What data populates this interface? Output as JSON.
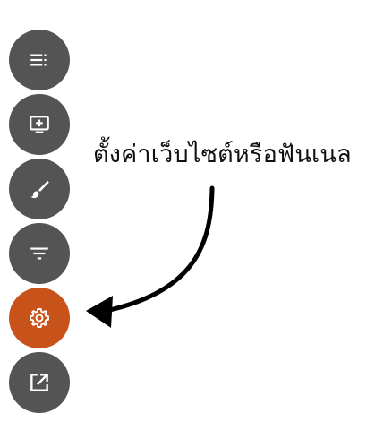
{
  "toolbar": {
    "buttons": [
      {
        "icon": "list-icon",
        "active": false
      },
      {
        "icon": "monitor-add-icon",
        "active": false
      },
      {
        "icon": "brush-icon",
        "active": false
      },
      {
        "icon": "filter-icon",
        "active": false
      },
      {
        "icon": "gear-icon",
        "active": true
      },
      {
        "icon": "open-external-icon",
        "active": false
      }
    ],
    "colors": {
      "default": "#545454",
      "active": "#c8531a",
      "icon": "#ffffff"
    }
  },
  "callout": {
    "text": "ตั้งค่าเว็บไซต์หรือฟันเนล"
  }
}
